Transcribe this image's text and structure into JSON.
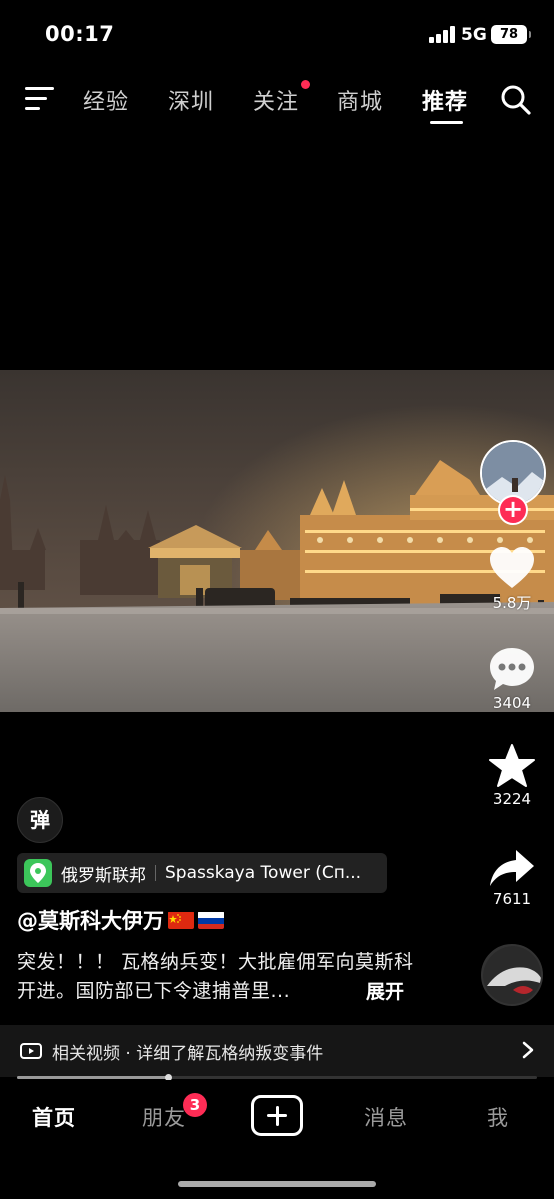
{
  "status": {
    "time": "00:17",
    "network": "5G",
    "battery": "78"
  },
  "nav": {
    "tabs": [
      {
        "label": "经验"
      },
      {
        "label": "深圳"
      },
      {
        "label": "关注"
      },
      {
        "label": "商城"
      },
      {
        "label": "推荐"
      }
    ],
    "active_tab": "推荐",
    "notification_dot_on": "关注"
  },
  "video": {
    "description_visible": "snowy Red Square at night"
  },
  "actions": {
    "likes": "5.8万",
    "comments": "3404",
    "favorites": "3224",
    "shares": "7611",
    "follow_symbol": "+"
  },
  "danmu": {
    "label": "弹"
  },
  "location": {
    "country": "俄罗斯联邦",
    "place": "Spasskaya Tower (Сп..."
  },
  "author": {
    "handle": "@莫斯科大伊万"
  },
  "caption": {
    "text": "突发！！！ 瓦格纳兵变！大批雇佣军向莫斯科开进。国防部已下令逮捕普里...",
    "expand_label": "展开"
  },
  "related": {
    "text": "相关视频 · 详细了解瓦格纳叛变事件"
  },
  "playback": {
    "progress": 0.29
  },
  "tabbar": {
    "home": "首页",
    "friends": "朋友",
    "friends_badge": "3",
    "messages": "消息",
    "me": "我"
  },
  "colors": {
    "accent": "#fe2c55",
    "location_green": "#3cc65a",
    "background": "#000000"
  }
}
